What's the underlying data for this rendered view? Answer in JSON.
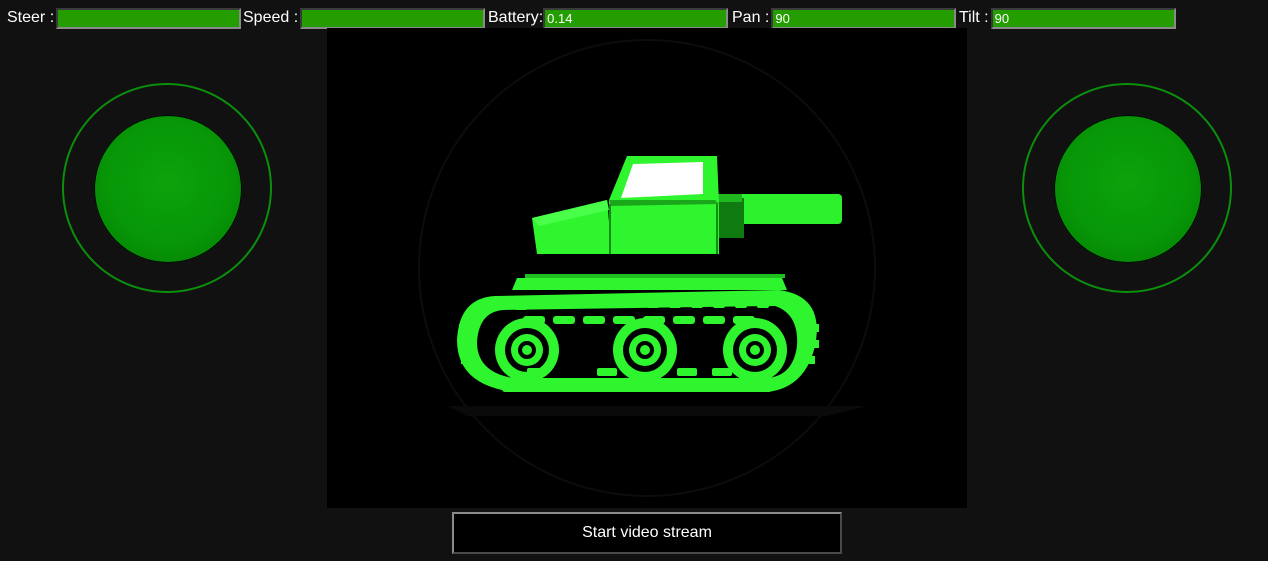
{
  "fields": {
    "steer": {
      "label": "Steer :",
      "value": ""
    },
    "speed": {
      "label": "Speed :",
      "value": ""
    },
    "battery": {
      "label": "Battery:",
      "value": "0.14"
    },
    "pan": {
      "label": "Pan :",
      "value": "90"
    },
    "tilt": {
      "label": "Tilt :",
      "value": "90"
    }
  },
  "joysticks": {
    "left": {
      "icon": "joystick-left"
    },
    "right": {
      "icon": "joystick-right"
    }
  },
  "video": {
    "placeholder_image": "tank-icon"
  },
  "controls": {
    "start_stream_label": "Start video stream"
  },
  "colors": {
    "background": "#111111",
    "accent_green": "#239d00",
    "joystick_green": "#079707",
    "tank_green": "#2ef52e"
  }
}
